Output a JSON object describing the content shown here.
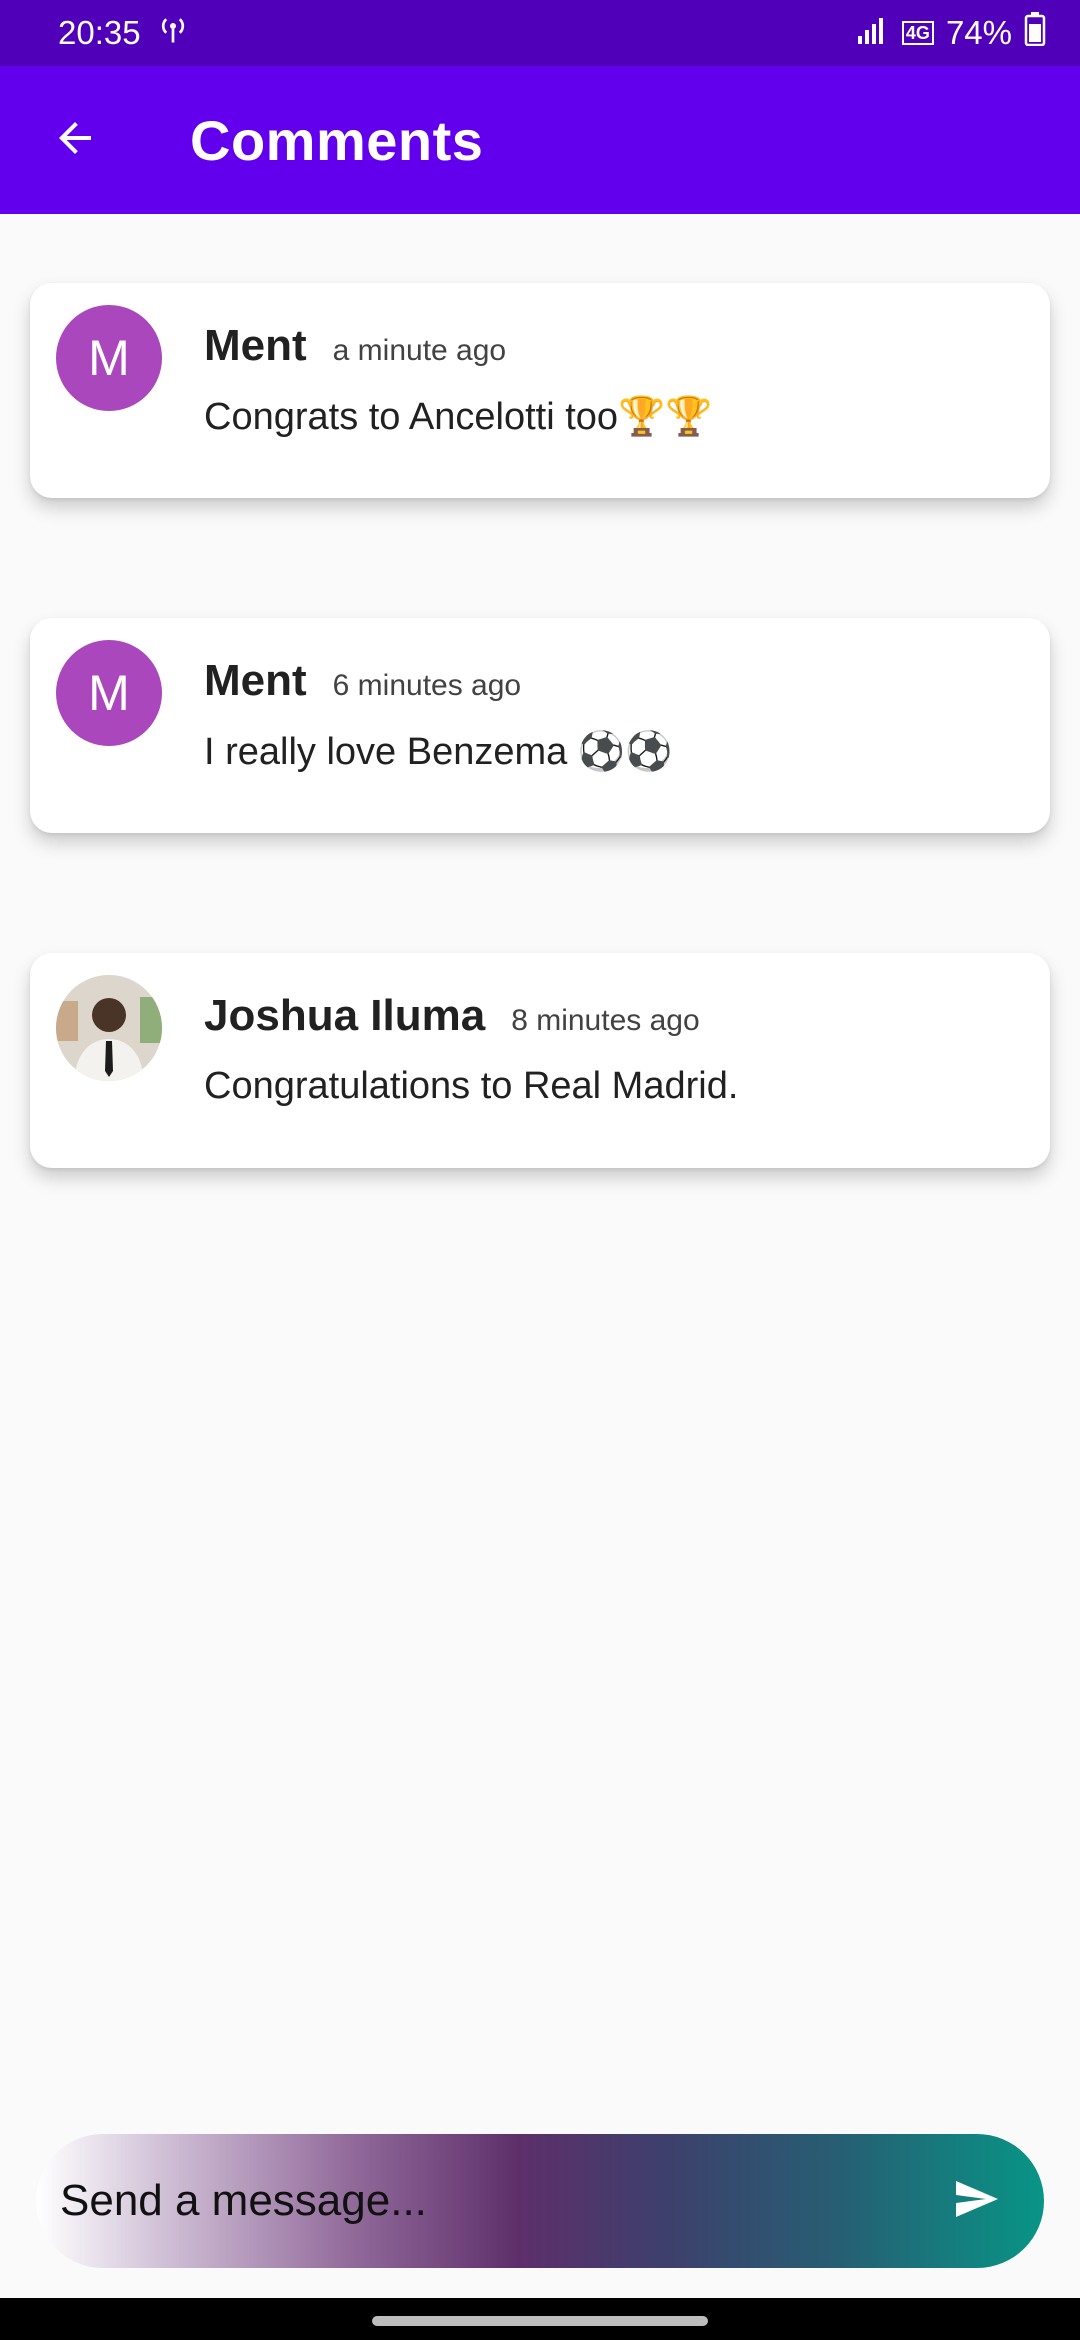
{
  "status_bar": {
    "time": "20:35",
    "network_type": "4G",
    "battery": "74%"
  },
  "header": {
    "title": "Comments"
  },
  "comments": [
    {
      "author": "Ment",
      "avatar_letter": "M",
      "time": "a minute ago",
      "text": "Congrats to Ancelotti too🏆🏆"
    },
    {
      "author": "Ment",
      "avatar_letter": "M",
      "time": "6 minutes ago",
      "text": "I really love Benzema ⚽⚽"
    },
    {
      "author": "Joshua Iluma",
      "avatar_letter": "",
      "time": "8 minutes ago",
      "text": "Congratulations to Real Madrid."
    }
  ],
  "composer": {
    "placeholder": "Send a message..."
  },
  "colors": {
    "status_bar": "#5000b8",
    "app_bar": "#6200ee",
    "avatar": "#ab47bc"
  }
}
